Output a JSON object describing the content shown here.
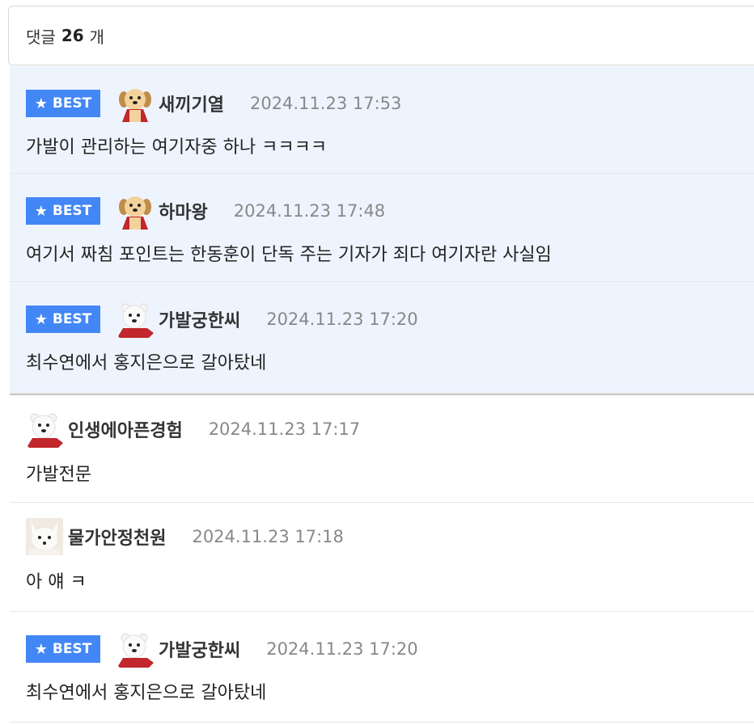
{
  "header": {
    "label": "댓글",
    "count": "26",
    "unit": "개"
  },
  "best_label": "BEST",
  "comments": [
    {
      "best": true,
      "avatar": "puppy-icon",
      "nickname": "새끼기열",
      "date": "2024.11.23 17:53",
      "text": "가발이 관리하는 여기자중 하나 ㅋㅋㅋㅋ"
    },
    {
      "best": true,
      "avatar": "puppy-icon",
      "nickname": "하마왕",
      "date": "2024.11.23 17:48",
      "text": "여기서 짜침 포인트는 한동훈이 단독 주는 기자가 죄다 여기자란 사실임"
    },
    {
      "best": true,
      "avatar": "polar-bear-icon",
      "nickname": "가발궁한씨",
      "date": "2024.11.23 17:20",
      "text": "최수연에서 홍지은으로 갈아탔네"
    },
    {
      "best": false,
      "avatar": "polar-bear-icon",
      "nickname": "인생에아픈경험",
      "date": "2024.11.23 17:17",
      "text": "가발전문"
    },
    {
      "best": false,
      "avatar": "arctic-fox-icon",
      "nickname": "물가안정천원",
      "date": "2024.11.23 17:18",
      "text": "아 얘 ㅋ"
    },
    {
      "best": true,
      "avatar": "polar-bear-icon",
      "nickname": "가발궁한씨",
      "date": "2024.11.23 17:20",
      "text": "최수연에서 홍지은으로 갈아탔네"
    }
  ]
}
